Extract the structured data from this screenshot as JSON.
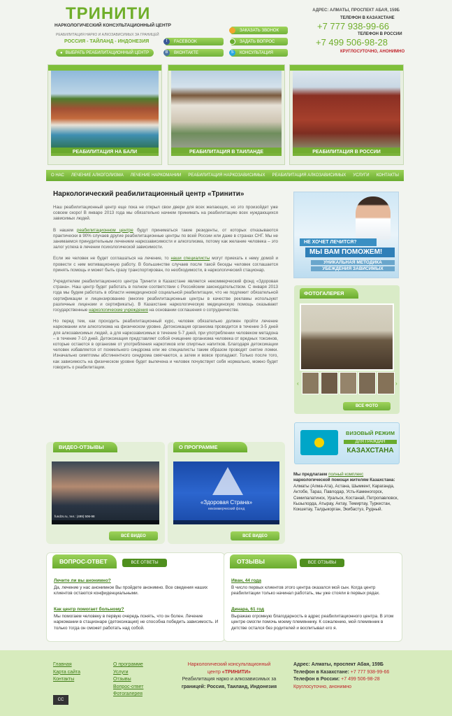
{
  "header": {
    "logo": "ТРИНИТИ",
    "subtitle": "НАРКОЛОГИЧЕСКИЙ КОНСУЛЬТАЦИОННЫЙ ЦЕНТР",
    "tagline": "РЕАБИЛИТАЦИЯ НАРКО И АЛКОЗАВИСИМЫХ ЗА ГРАНИЦЕЙ",
    "countries": "РОССИЯ - ТАЙЛАНД - ИНДОНЕЗИЯ",
    "choose_center": "ВЫБРАТЬ РЕАБИЛИТАЦИОННЫЙ ЦЕНТР",
    "facebook": "FACEBOOK",
    "vkontakte": "ВКОНТАКТЕ",
    "order_call": "ЗАКАЗАТЬ ЗВОНОК",
    "ask_question": "ЗАДАТЬ ВОПРОС",
    "consultation": "КОНСУЛЬТАЦИЯ",
    "address": "АДРЕС: АЛМАТЫ, ПРОСПЕКТ АБАЯ, 159Б",
    "phone_kz_label": "ТЕЛЕФОН В КАЗАХСТАНЕ",
    "phone_kz": "+7 777 938-99-66",
    "phone_ru_label": "ТЕЛЕФОН В РОССИИ",
    "phone_ru": "+7 499 506-98-28",
    "hours": "КРУГЛОСУТОЧНО, АНОНИМНО"
  },
  "banners": [
    "РЕАБИЛИТАЦИЯ НА БАЛИ",
    "РЕАБИЛИТАЦИЯ В ТАИЛАНДЕ",
    "РЕАБИЛИТАЦИЯ В РОССИИ"
  ],
  "nav": [
    "О НАС",
    "ЛЕЧЕНИЕ АЛКОГОЛИЗМА",
    "ЛЕЧЕНИЕ НАРКОМАНИИ",
    "РЕАБИЛИТАЦИЯ НАРКОЗАВИСИМЫХ",
    "РЕАБИЛИТАЦИЯ АЛКОЗАВИСИМЫХ",
    "УСЛУГИ",
    "КОНТАКТЫ"
  ],
  "article": {
    "title": "Наркологический реабилитационный центр «Тринити»",
    "p1": "Наш реабилитационный центр еще пока не открыл свои двери для всех желающих, но это произойдет уже совсем скоро! В январе 2013 года мы обязательно начнем принимать на реабилитацию всех нуждающихся зависимых людей.",
    "p2a": "В нашем",
    "p2link": "реабилитационном центре",
    "p2b": "будут приниматься такие резиденты, от которых отказываются практически в 90% случаев другие реабилитационные центры по всей России или даже в странах СНГ. Мы не занимаемся принудительным лечением наркозависимости и алкоголизма, потому как желание человека – это залог успеха в лечении психологической зависимости.",
    "p3a": "Если же человек не будет соглашаться на лечение, то",
    "p3link": "наши специалисты",
    "p3b": "могут приехать к нему домой и провести с ним мотивационную работу. В большинстве случаев после такой беседы человек соглашается принять помощь и может быть сразу транспортирован, по необходимости, в наркологический стационар.",
    "p4a": "Учредителем реабилитационного центра Тринити в Казахстане является некоммерческий фонд «Здоровая страна». Наш центр будет работать в полном соответствии с Российским законодательством. С января 2013 года мы будем работать в области немедицинской социальной реабилитации, что не подлежит обязательной сертификации и лицензированию (многие реабилитационные центры в качестве рекламы используют различные лицензии и сертификаты). В Казахстане наркологическую медицинскую помощь оказывают государственные",
    "p4link": "наркологические учреждения",
    "p4b": "на основании соглашения о сотрудничестве.",
    "p5": "Но перед тем, как проходить реабилитационный курс, человек обязательно должен пройти лечение наркомании или алкоголизма на физическом уровне. Детоксикация организма проводится в течение 3-5 дней для алкозависимых людей, а для наркозависимых в течение 5-7 дней, при употреблении человеком метадона – в течение 7-10 дней. Детоксикация представляет собой очищение организма человека от вредных токсинов, которые остаются в организме от употребления наркотиков или спиртных напитков. Благодаря детоксикации человек избавляется от похмельного синдрома или же специалисты таким образом проводят снятие ломки. Изначально симптомы абстинентного синдрома смягчаются, а затем и вовсе пропадают. Только после того, как зависимость на физическом уровне будет вылечена и человек почувствует себя нормально, можно будет говорить о реабилитации."
  },
  "promo": {
    "q": "НЕ ХОЧЕТ ЛЕЧИТСЯ?",
    "a": "МЫ ВАМ ПОМОЖЕМ!",
    "m1": "УНИКАЛЬНАЯ МЕТОДИКА",
    "m2": "УБЕЖДЕНИЯ ЗАВИСИМЫХ"
  },
  "gallery": {
    "title": "ФОТОГАЛЕРЕЯ",
    "all": "ВСЕ ФОТО"
  },
  "visa": {
    "l1": "ВИЗОВЫЙ РЕЖИМ",
    "l2": "ДЛЯ ГРАЖДАН",
    "l3": "КАЗАХСТАНА"
  },
  "offer": {
    "a": "Мы предлагаем",
    "link": "полный комплекс",
    "b": "наркологической помощи жителям",
    "c": "Казахстана:",
    "cities": "Алматы (Алма-Ата), Астана, Шымкент, Караганда, Актобе, Тараз, Павлодар, Усть-Каменогорск, Семипалатинск, Уральск, Костанай, Петропавловск, Кызылорда, Атырау, Актау, Темиртау, Туркестан, Кокшетау, Талдыкорган, Экибастуз, Рудный."
  },
  "video": {
    "title": "ВИДЕО-ОТЗЫВЫ",
    "all": "ВСЁ ВИДЕО",
    "caption": "fundzs.ru, тел.: (499) 506-98"
  },
  "about": {
    "title": "О ПРОГРАММЕ",
    "all": "ВСЁ ВИДЕО",
    "logo": "«Здоровая Страна»",
    "logo_sub": "некоммерческий фонд"
  },
  "faq": {
    "title": "ВОПРОС-ОТВЕТ",
    "all": "ВСЕ ОТВЕТЫ",
    "items": [
      {
        "q": "Лечите ли вы анонимно?",
        "a": "Да, лечение у нас анонимное Вы пройдете анонимно. Все сведения наших клиентов остаются конфиденциальными."
      },
      {
        "q": "Как центр помогает больному?",
        "a": "Мы помогаем человеку в первую очередь понять, что он болен. Лечение наркомании в стационаре (детоксикация) не способна победить зависимость. И только тогда он сможет работать над собой."
      }
    ]
  },
  "reviews": {
    "title": "ОТЗЫВЫ",
    "all": "ВСЕ ОТЗЫВЫ",
    "items": [
      {
        "q": "Иван, 44 года",
        "a": "В число первых клиентов этого центра оказался мой сын. Когда центр реабилитации только начинал работать, мы уже стояли в первых рядах."
      },
      {
        "q": "Динара, 61 год",
        "a": "Выражаю огромную благодарность в адрес реабилитационного центра. В этом центре смогли помочь моему племяннику. К сожалению, мой племянник в детстве остался без родителей и воспитывал его я."
      }
    ]
  },
  "footer": {
    "col1": [
      "Главная",
      "Карта сайта",
      "Контакты"
    ],
    "col2": [
      "О программе",
      "Услуги",
      "Отзывы",
      "Вопрос-ответ",
      "Фотогалерея"
    ],
    "c1": "Наркологический консультационный",
    "c2a": "центр",
    "c2b": "«ТРИНИТИ»",
    "c3": "Реабилитация нарко и алкозависимых за",
    "c4": "границей: Россия, Таиланд, Индонезия",
    "addr": "Адрес: Алматы, проспект Абая, 159Б",
    "kz_label": "Телефон в Казахстане:",
    "kz": "+7 777 938-99-66",
    "ru_label": "Телефон в России:",
    "ru": "+7 499 506-98-28",
    "hours": "Круглосуточно, анонимно",
    "badge": "CC"
  }
}
